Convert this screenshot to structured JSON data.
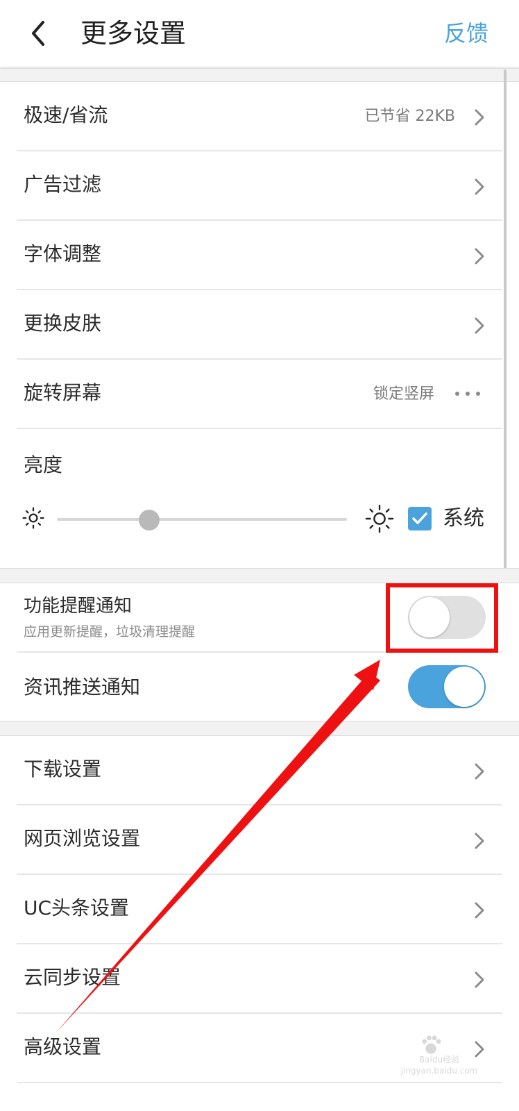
{
  "header": {
    "title": "更多设置",
    "feedback": "反馈"
  },
  "rows": {
    "speed": {
      "label": "极速/省流",
      "value": "已节省 22KB"
    },
    "adfilter": {
      "label": "广告过滤"
    },
    "font": {
      "label": "字体调整"
    },
    "skin": {
      "label": "更换皮肤"
    },
    "rotate": {
      "label": "旋转屏幕",
      "value": "锁定竖屏"
    }
  },
  "brightness": {
    "label": "亮度",
    "level": 0.32,
    "system_label": "系统",
    "system_checked": true
  },
  "notifications": {
    "feature": {
      "label": "功能提醒通知",
      "sublabel": "应用更新提醒，垃圾清理提醒",
      "enabled": false
    },
    "news": {
      "label": "资讯推送通知",
      "enabled": true
    }
  },
  "more": {
    "download": "下载设置",
    "browsing": "网页浏览设置",
    "uc_news": "UC头条设置",
    "cloud": "云同步设置",
    "advanced": "高级设置"
  },
  "colors": {
    "accent": "#4aa3dc",
    "annotation": "#ee1111"
  },
  "watermark": "Baidu经验 jingyan.baidu.com"
}
